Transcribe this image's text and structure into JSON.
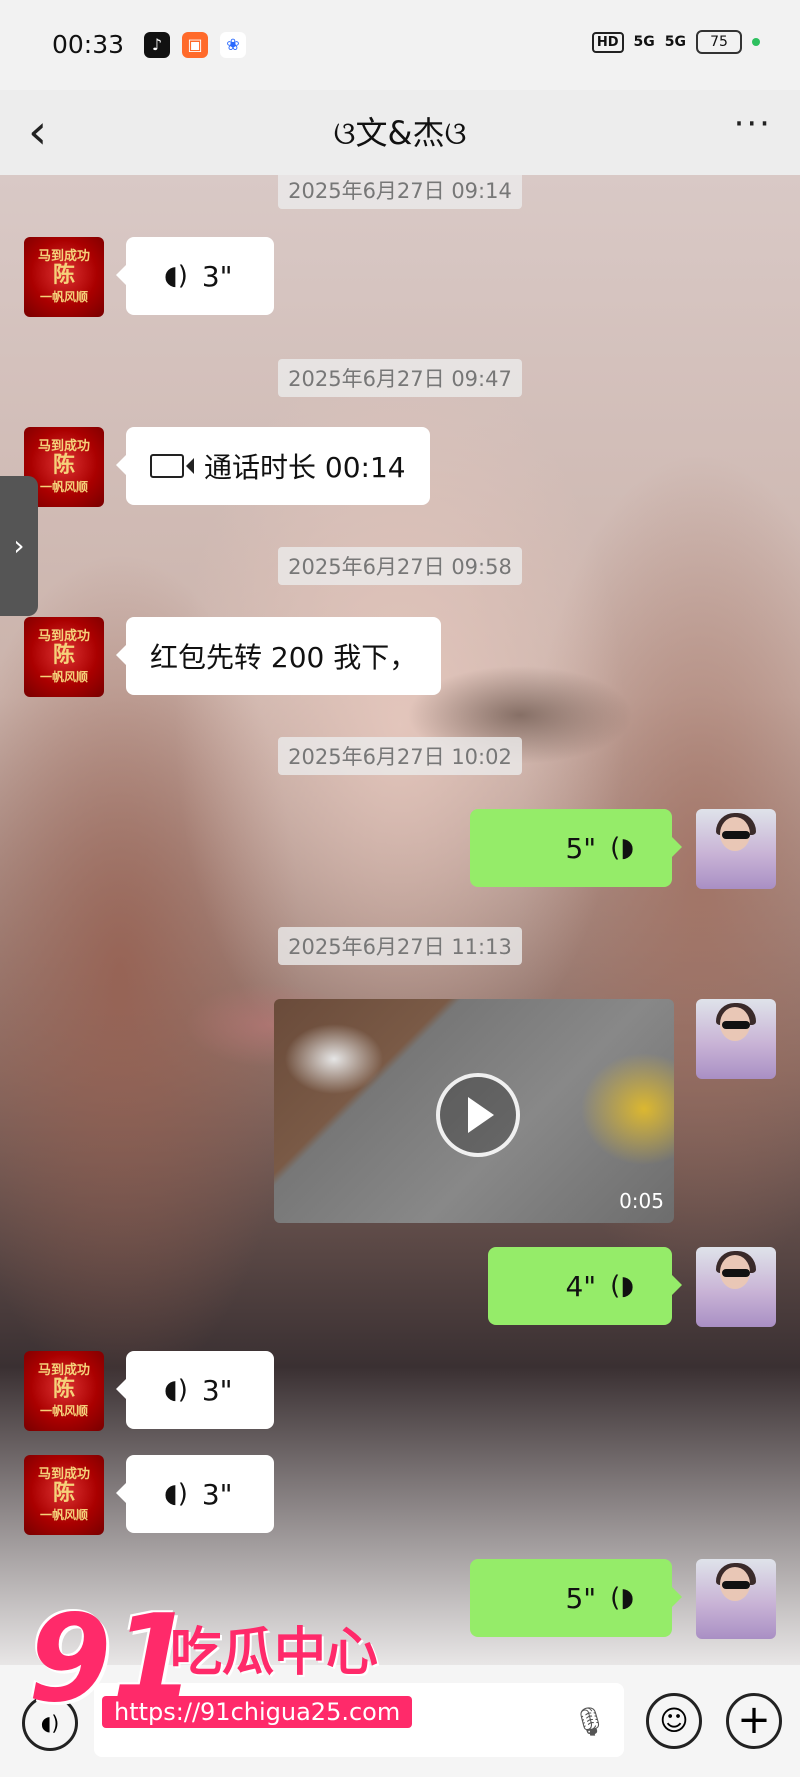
{
  "status_bar": {
    "time": "00:33",
    "apps": [
      "tiktok-icon",
      "app-icon",
      "paw-icon"
    ],
    "hd": "HD",
    "signal1": "5G",
    "signal2": "5G",
    "battery": "75"
  },
  "header": {
    "back_icon": "‹",
    "title": "ଓ文&杰ଓ",
    "more_icon": "···"
  },
  "avatar_left": {
    "line1": "马到成功",
    "line2": "陈",
    "line3": "一帆风顺"
  },
  "messages": [
    {
      "type": "timestamp",
      "text": "2025年6月27日 09:14"
    },
    {
      "type": "voice",
      "side": "left",
      "duration": "3\""
    },
    {
      "type": "timestamp",
      "text": "2025年6月27日 09:47"
    },
    {
      "type": "call",
      "side": "left",
      "text": "通话时长 00:14"
    },
    {
      "type": "timestamp",
      "text": "2025年6月27日 09:58"
    },
    {
      "type": "text",
      "side": "left",
      "text": "红包先转 200 我下，"
    },
    {
      "type": "timestamp",
      "text": "2025年6月27日 10:02"
    },
    {
      "type": "voice",
      "side": "right",
      "duration": "5\""
    },
    {
      "type": "timestamp",
      "text": "2025年6月27日 11:13"
    },
    {
      "type": "video",
      "side": "right",
      "duration": "0:05"
    },
    {
      "type": "voice",
      "side": "right",
      "duration": "4\""
    },
    {
      "type": "voice",
      "side": "left",
      "duration": "3\""
    },
    {
      "type": "voice",
      "side": "left",
      "duration": "3\""
    },
    {
      "type": "voice",
      "side": "right",
      "duration": "5\""
    }
  ],
  "input_bar": {
    "voice_icon": "voice-icon",
    "mic_icon": "mic-icon",
    "emoji_icon": "emoji-icon",
    "plus_icon": "plus-icon"
  },
  "watermark": {
    "num": "91",
    "text": "吃瓜中心",
    "url": "https://91chigua25.com"
  },
  "colors": {
    "green_bubble": "#95ec69",
    "white_bubble": "#ffffff",
    "watermark": "#ff2a6a"
  }
}
